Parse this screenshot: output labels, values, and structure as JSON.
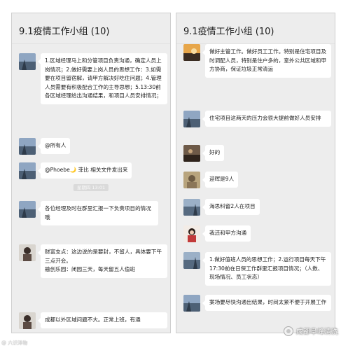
{
  "left_chat": {
    "title": "9.1疫情工作小组 (10)",
    "messages": [
      {
        "text": "1.区域经理马上和分管项目负责沟通，确定人员上岗情况；2.做好需要上岗人员的思想工作：3.如需要在项目留宿解，请甲方解决好吃住问题；4.管理人员需要有积极配合工作的主导思想；5.13:30前各区域经理给出沟通结果，和项目人员安排情况；"
      },
      {
        "text": "@所有人"
      },
      {
        "text": "@Phoebe🌙 菲比 相关文件发出来"
      },
      {
        "time": "星期四 13:01"
      },
      {
        "text": "各位经理及时在群里汇报一下负责项目的情况哦"
      },
      {
        "text": "财富支点：这边说的是要封，不留人，具体要下午三点开会。\n融创乐园：闭园三天，每天留五人值班"
      },
      {
        "text": "成都以外区域问题不大。正常上班，有通"
      }
    ]
  },
  "right_chat": {
    "title": "9.1疫情工作小组 (10)",
    "messages": [
      {
        "text": "做好主管工作。做好员工工作。特别是住宅项目及时调配人员，特别是住户多的，室外公共区域和甲方协商，保证垃圾正常清运"
      },
      {
        "text": "住宅项目这两天的压力会很大提前做好人员安排"
      },
      {
        "text": "好的"
      },
      {
        "text": "迎晖是9人"
      },
      {
        "text": "海思科留2人在项目"
      },
      {
        "text": "我还和甲方沟通"
      },
      {
        "text": "1.做好值班人员的思想工作；2.运行项目每天下午17:30前在日保工作群里汇报项目情况；（人数、现场情况、员工状态）"
      },
      {
        "text": "案场要尽快沟通出结果，时间太紧不便于开展工作"
      }
    ]
  },
  "watermark": {
    "brand": "成都阜峰清洗",
    "left_mark": "@ 六识泽物"
  },
  "colors": {
    "panel_bg": "#ededed",
    "bubble_bg": "#ffffff",
    "time_pill_bg": "#dadada"
  }
}
